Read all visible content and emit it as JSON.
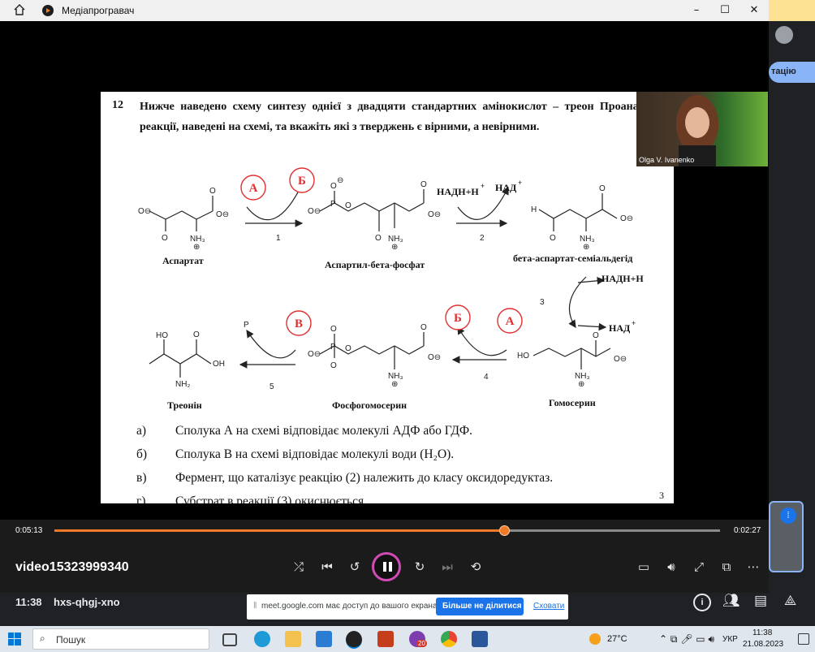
{
  "player": {
    "title": "Медіапрогравач",
    "current_time": "0:05:13",
    "total_time": "0:02:27",
    "progress_fraction": 0.676,
    "video_name": "video15323999340"
  },
  "slide": {
    "question_number": "12",
    "question_text": "Нижче наведено схему синтезу однієї з двадцяти стандартних амінокислот – треон Проаналізуйте реакції, наведені на схемі, та вкажіть які з тверджень є вірними, а невірними.",
    "compounds": {
      "aspartate": "Аспартат",
      "aspartyl_phosphate": "Аспартил-бета-фосфат",
      "semialdehyde": "бета-аспартат-семіальдегід",
      "homoserine": "Гомосерин",
      "phosphohomoserine": "Фосфогомосерин",
      "threonine": "Треонін"
    },
    "markers": {
      "a": "А",
      "b": "Б",
      "v": "В"
    },
    "cofactors": {
      "nadh": "НАДН+Н",
      "nad": "НАД",
      "plus": "+",
      "p": "P"
    },
    "step_numbers": [
      "1",
      "2",
      "3",
      "4",
      "5"
    ],
    "atoms": {
      "o": "O",
      "o_minus": "O⊖",
      "oh": "OH",
      "ho": "HO",
      "h": "H",
      "p": "P",
      "nh3": "NH₃",
      "nh2": "NH₂",
      "plus_charge": "⊕",
      "minus_charge": "⊖"
    },
    "options": [
      {
        "letter": "а)",
        "text": "Сполука А на схемі відповідає молекулі АДФ або ГДФ."
      },
      {
        "letter": "б)",
        "text": "Сполука В на схемі відповідає молекулі води (H₂O)."
      },
      {
        "letter": "в)",
        "text": "Фермент, що каталізує реакцію (2) належить до класу оксидоредуктаз."
      },
      {
        "letter": "г)",
        "text": "Субстрат в реакції (3) окиснюється."
      }
    ],
    "page_number": "3"
  },
  "webcam": {
    "name": "Olga V. Ivanenko"
  },
  "meet": {
    "right_button_label": "тацію",
    "clock": "11:38",
    "meeting_code": "hxs-qhgj-xno",
    "share_notice": "meet.google.com має доступ до вашого екрана.",
    "stop_share_label": "Більше не ділитися",
    "hide_label": "Сховати"
  },
  "taskbar": {
    "search_placeholder": "Пошук",
    "weather": "27°C",
    "language": "УКР",
    "time": "11:38",
    "date": "21.08.2023",
    "badge_count": "20"
  },
  "colors": {
    "accent_orange": "#f07a2a",
    "play_ring": "#d14bb6",
    "marker_red": "#e03030",
    "meet_blue": "#1a73e8"
  }
}
